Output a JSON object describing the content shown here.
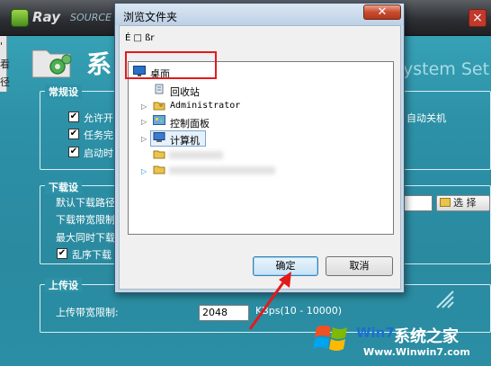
{
  "app": {
    "logo_text": "Ray",
    "logo_sub": "SOURCE",
    "close_glyph": "×",
    "left_strip_chars": [
      "'",
      "看",
      "径"
    ],
    "heading": "系",
    "heading_en": "ystem Set",
    "accent_color": "#2b8fa3"
  },
  "general": {
    "title": "常规设",
    "rows": [
      {
        "label": "允许开",
        "checked": true
      },
      {
        "label": "任务完",
        "checked": true
      },
      {
        "label": "启动时",
        "checked": true
      }
    ],
    "right_text": "自动关机"
  },
  "download": {
    "title": "下载设",
    "rows": [
      {
        "label": "默认下载路径"
      },
      {
        "label": "下载带宽限制"
      },
      {
        "label": "最大同时下载"
      }
    ],
    "checkbox_label": "乱序下载",
    "browse_label": "选 择"
  },
  "upload": {
    "title": "上传设",
    "bandwidth_label": "上传带宽限制:",
    "bandwidth_value": "2048",
    "unit_text": "KBps(10 - 10000)"
  },
  "watermark": {
    "brand": "Win7",
    "brand_cn": "系统之家",
    "url": "Www.Winwin7.com"
  },
  "dialog": {
    "title": "浏览文件夹",
    "close_glyph": "✕",
    "description": "É □ ßr",
    "tree": {
      "root": "桌面",
      "items": [
        {
          "label": "回收站",
          "icon": "recycle-bin-icon",
          "expandable": false
        },
        {
          "label": "Administrator",
          "icon": "user-folder-icon",
          "expandable": true
        },
        {
          "label": "控制面板",
          "icon": "control-panel-icon",
          "expandable": true
        },
        {
          "label": "计算机",
          "icon": "computer-icon",
          "expandable": true,
          "selected": true
        },
        {
          "label": "",
          "icon": "folder-icon",
          "expandable": false
        },
        {
          "label": "",
          "icon": "folder-icon",
          "expandable": true
        }
      ]
    },
    "ok_label": "确定",
    "cancel_label": "取消"
  }
}
